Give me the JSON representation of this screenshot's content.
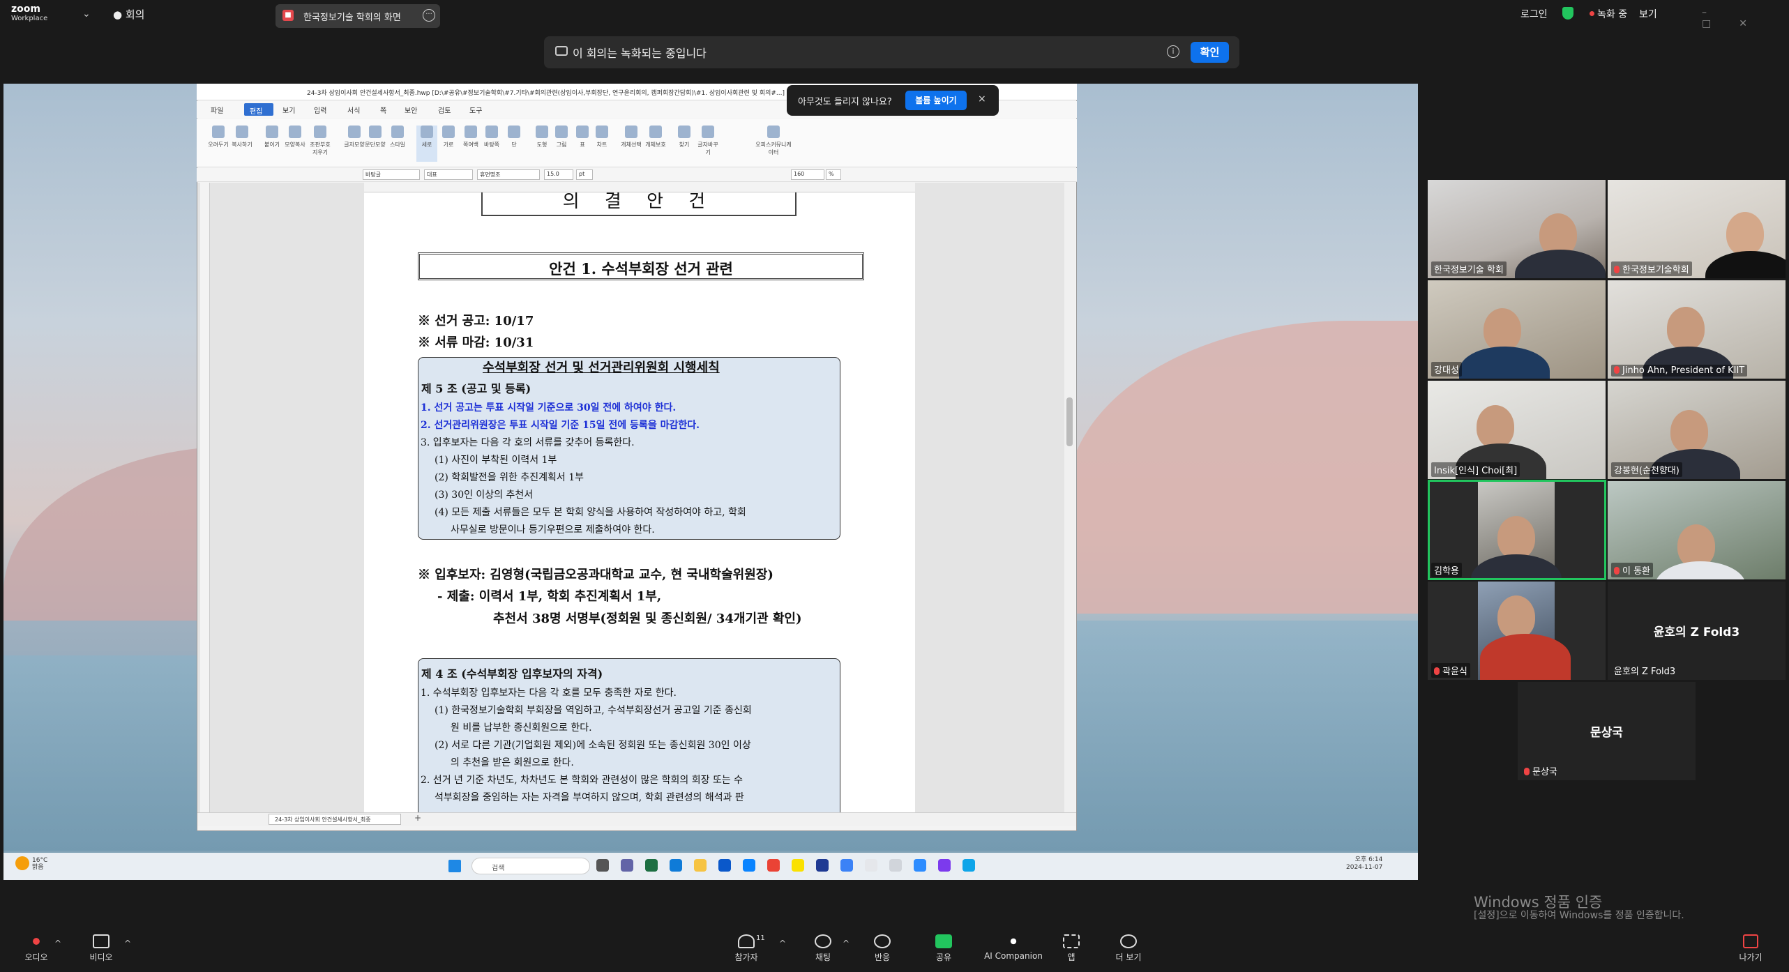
{
  "topbar": {
    "brand": "zoom",
    "brand_sub": "Workplace",
    "meeting_menu": "회의",
    "share_tab": "한국정보기술 학회의 화면",
    "login": "로그인",
    "recording": "녹화 중",
    "view": "보기"
  },
  "rec_banner": {
    "text": "이 회의는 녹화되는 중입니다",
    "confirm": "확인"
  },
  "popup": {
    "text": "아무것도 들리지 않나요?",
    "button": "볼륨 높이기",
    "close": "×"
  },
  "hwp": {
    "title": "24-3차 상임이사회 안건설세사항서_최종.hwp [D:\\#공유\\#정보기술학회\\#7.기타\\#회의관련(상임이사,부회장단, 연구윤리회의, 캠퍼회장간담회)\\#1. 상임이사회관련 및 회의#...]",
    "menu": [
      "파일",
      "편집",
      "보기",
      "입력",
      "서식",
      "쪽",
      "보안",
      "검토",
      "도구"
    ],
    "ribbon": [
      "오려두기",
      "복사하기",
      "붙이기",
      "모양복사",
      "조판부호지우기",
      "글자모양",
      "문단모양",
      "스타일",
      "세로",
      "가로",
      "쪽여백",
      "바탕쪽",
      "단",
      "도형",
      "그림",
      "표",
      "차트",
      "개체선택",
      "개체보호",
      "찾기",
      "글자바꾸기",
      "오피스커뮤니케이터"
    ],
    "fmt": {
      "style": "바탕글",
      "lang": "대표",
      "font": "휴먼명조",
      "size": "15.0",
      "unit": "pt",
      "zoom": "160",
      "zoom_unit": "%"
    },
    "doc_tab": "24-3차 상임이사회 안건설세사항서_최종",
    "sheet_add": "+"
  },
  "document": {
    "top_title": "의 결 안 건",
    "agenda": "안건 1. 수석부회장 선거 관련",
    "line1": "※ 선거 공고: 10/17",
    "line2": "※ 서류 마감: 10/31",
    "box1": {
      "title": "수석부회장 선거 및 선거관리위원회 시행세칙",
      "article": "제 5 조 (공고 및 등록)",
      "lines": [
        "1. 선거 공고는 투표 시작일 기준으로 30일 전에 하여야 한다.",
        "2. 선거관리위원장은 투표 시작일 기준 15일 전에 등록을 마감한다.",
        "3. 입후보자는 다음 각 호의 서류를 갖추어 등록한다.",
        "(1) 사진이 부착된 이력서 1부",
        "(2) 학회발전을 위한 추진계획서 1부",
        "(3) 30인 이상의 추천서",
        "(4) 모든 제출 서류들은 모두 본 학회 양식을 사용하여 작성하여야 하고, 학회",
        "사무실로 방문이나 등기우편으로 제출하여야 한다."
      ]
    },
    "candidate": "※ 입후보자: 김영형(국립금오공과대학교 교수, 현 국내학술위원장)",
    "submit1": "- 제출: 이력서 1부, 학회 추진계획서 1부,",
    "submit2": "추천서 38명 서명부(정회원 및 종신회원/ 34개기관 확인)",
    "box2": {
      "article": "제 4 조 (수석부회장 입후보자의 자격)",
      "lines": [
        "1. 수석부회장 입후보자는 다음 각 호를 모두 충족한 자로 한다.",
        "(1) 한국정보기술학회 부회장을 역임하고, 수석부회장선거 공고일 기준 종신회",
        "원 비를 납부한 종신회원으로 한다.",
        "(2) 서로 다른 기관(기업회원 제외)에 소속된 정회원 또는 종신회원 30인 이상",
        "의 추천을 받은 회원으로 한다.",
        "2. 선거 년 기준 차년도, 차차년도 본 학회와 관련성이 많은 학회의 회장 또는 수",
        "석부회장을 중임하는 자는 자격을 부여하지 않으며, 학회 관련성의 해석과 판"
      ]
    }
  },
  "taskbar": {
    "temp": "16°C",
    "weather": "맑음",
    "search": "검색",
    "time": "오후 6:14",
    "date": "2024-11-07"
  },
  "participants": [
    {
      "name": "한국정보기술 학회",
      "muted": false
    },
    {
      "name": "한국정보기술학회",
      "muted": true
    },
    {
      "name": "강대성",
      "muted": false
    },
    {
      "name": "Jinho Ahn, President of KIIT",
      "muted": true
    },
    {
      "name": "Insik[인식] Choi[최]",
      "muted": false
    },
    {
      "name": "강봉현(순천향대)",
      "muted": false
    },
    {
      "name": "김학용",
      "muted": false
    },
    {
      "name": "이 동환",
      "muted": true
    },
    {
      "name": "곽윤식",
      "muted": true
    },
    {
      "name": "윤호의 Z Fold3",
      "big": "윤호의 Z Fold3",
      "muted": false
    },
    {
      "name": "문상국",
      "big": "문상국",
      "muted": true
    }
  ],
  "watermark": {
    "line1": "Windows 정품 인증",
    "line2": "[설정]으로 이동하여 Windows를 정품 인증합니다."
  },
  "toolbar": {
    "audio": "오디오",
    "video": "비디오",
    "participants": "참가자",
    "participants_count": "11",
    "chat": "채팅",
    "react": "반응",
    "share": "공유",
    "ai": "AI Companion",
    "apps": "앱",
    "more": "더 보기",
    "leave": "나가기"
  }
}
